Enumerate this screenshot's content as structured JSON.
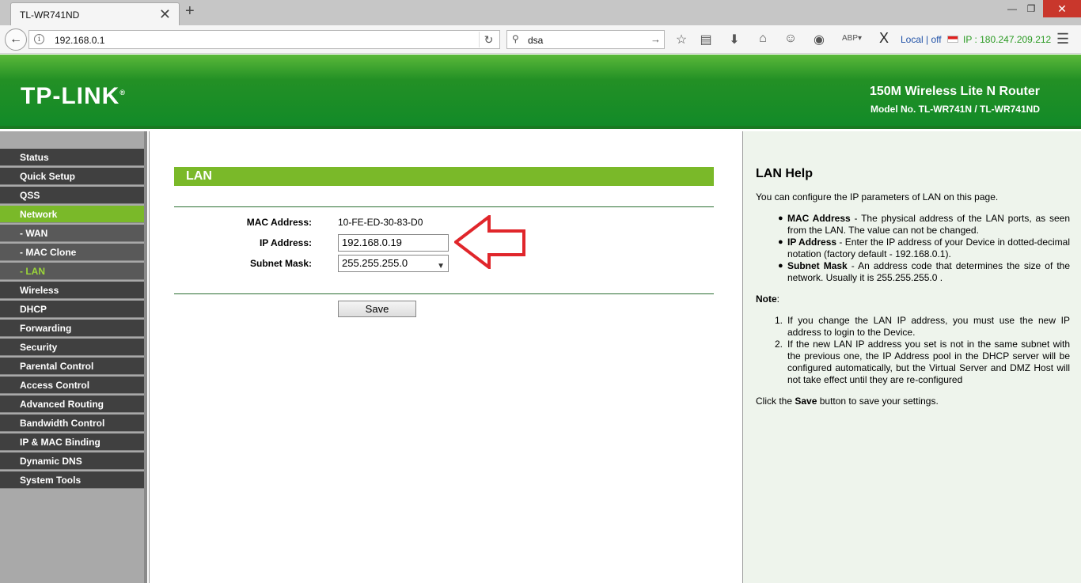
{
  "browser": {
    "tab_title": "TL-WR741ND",
    "close_glyph": "✕",
    "newtab_glyph": "+",
    "url": "192.168.0.1",
    "search_query": "dsa",
    "local_label": "Local | off",
    "ip_label": "IP : 180.247.209.212"
  },
  "header": {
    "logo": "TP-LINK",
    "product": "150M Wireless Lite N Router",
    "model": "Model No. TL-WR741N / TL-WR741ND"
  },
  "sidebar": {
    "items": [
      {
        "label": "Status"
      },
      {
        "label": "Quick Setup"
      },
      {
        "label": "QSS"
      },
      {
        "label": "Network"
      },
      {
        "label": "- WAN"
      },
      {
        "label": "- MAC Clone"
      },
      {
        "label": "- LAN"
      },
      {
        "label": "Wireless"
      },
      {
        "label": "DHCP"
      },
      {
        "label": "Forwarding"
      },
      {
        "label": "Security"
      },
      {
        "label": "Parental Control"
      },
      {
        "label": "Access Control"
      },
      {
        "label": "Advanced Routing"
      },
      {
        "label": "Bandwidth Control"
      },
      {
        "label": "IP & MAC Binding"
      },
      {
        "label": "Dynamic DNS"
      },
      {
        "label": "System Tools"
      }
    ]
  },
  "main": {
    "title": "LAN",
    "mac_label": "MAC Address:",
    "mac_value": "10-FE-ED-30-83-D0",
    "ip_label": "IP Address:",
    "ip_value": "192.168.0.19",
    "subnet_label": "Subnet Mask:",
    "subnet_value": "255.255.255.0",
    "save_label": "Save"
  },
  "help": {
    "title": "LAN Help",
    "intro": "You can configure the IP parameters of LAN on this page.",
    "b1_term": "MAC Address",
    "b1_text": " - The physical address of the LAN ports, as seen from the LAN. The value can not be changed.",
    "b2_term": "IP Address",
    "b2_text": " - Enter the IP address of your Device in dotted-decimal notation (factory default - 192.168.0.1).",
    "b3_term": "Subnet Mask",
    "b3_text": " - An address code that determines the size of the network. Usually it is 255.255.255.0 .",
    "note_label": "Note",
    "note_colon": ":",
    "n1": "If you change the LAN IP address, you must use the new IP address to login to the Device.",
    "n2": "If the new LAN IP address you set is not in the same subnet with the previous one, the IP Address pool in the DHCP server will be configured automatically, but the Virtual Server and DMZ Host will not take effect until they are re-configured",
    "footer_pre": "Click the ",
    "footer_bold": "Save",
    "footer_post": " button to save your settings."
  },
  "colors": {
    "green_accent": "#7ab929",
    "header_green": "#128a28",
    "arrow_red": "#e0262b"
  }
}
